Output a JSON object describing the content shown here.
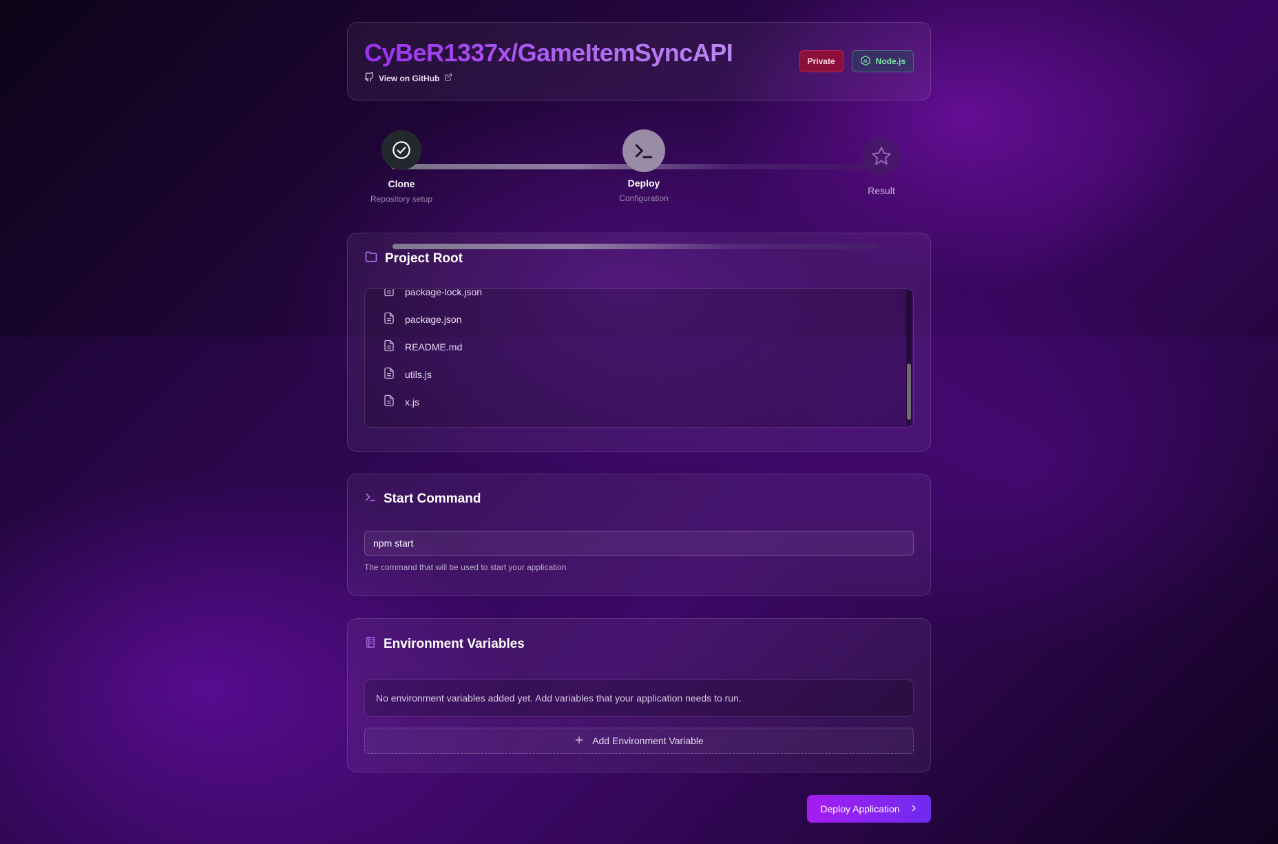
{
  "repo": {
    "title": "CyBeR1337x/GameItemSyncAPI",
    "github_link": "View on GitHub",
    "badges": {
      "private": "Private",
      "runtime": "Node.js"
    }
  },
  "steps": [
    {
      "label": "Clone",
      "sub": "Repository setup",
      "state": "complete",
      "icon": "check-circle-icon"
    },
    {
      "label": "Deploy",
      "sub": "Configuration",
      "state": "active",
      "icon": "terminal-icon"
    },
    {
      "label": "Result",
      "sub": "",
      "state": "pending",
      "icon": "star-icon"
    }
  ],
  "project_root": {
    "title": "Project Root",
    "files": [
      "package-lock.json",
      "package.json",
      "README.md",
      "utils.js",
      "x.js"
    ]
  },
  "start_command": {
    "title": "Start Command",
    "value": "npm start",
    "help": "The command that will be used to start your application"
  },
  "env": {
    "title": "Environment Variables",
    "empty_text": "No environment variables added yet. Add variables that your application needs to run.",
    "add_label": "Add Environment Variable"
  },
  "deploy_button": {
    "label": "Deploy Application"
  },
  "colors": {
    "accent": "#9d2ff0",
    "private_badge": "#8a0f3a",
    "node_text": "#7fe7a7",
    "deploy_gradient_start": "#a51df0",
    "deploy_gradient_end": "#6e2bf0"
  }
}
